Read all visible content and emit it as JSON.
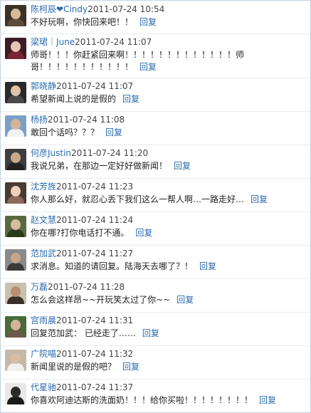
{
  "reply_label": "回复",
  "comments": [
    {
      "name": "陈柯辰",
      "heart": "❤",
      "name2": "Cindy",
      "time": "2011-07-24 10:54",
      "text": "不好玩啊，你快回来吧！！"
    },
    {
      "name": "梁珺",
      "sep": "｜",
      "name2": "June",
      "time": "2011-07-24 11:07",
      "text": "师哥！！！你赶紧回来啊！！！！！！！！！！！！！师哥！！！！！！！！！！！"
    },
    {
      "name": "郭晓静",
      "time": "2011-07-24 11:07",
      "text": "希望新闻上说的是假的"
    },
    {
      "name": "杨扬",
      "time": "2011-07-24 11:08",
      "text": "敢回个话吗？？？"
    },
    {
      "name": "何彦Justin",
      "time": "2011-07-24 11:20",
      "text": "我说兄弟，在那边一定好好做新闻！"
    },
    {
      "name": "沈芳旌",
      "time": "2011-07-24 11:23",
      "text": "你人那么好，就忍心丢下我们这么一帮人啊…一路走好…"
    },
    {
      "name": "赵文慧",
      "time": "2011-07-24 11:24",
      "text": "你在哪?打你电话打不通。"
    },
    {
      "name": "范加武",
      "time": "2011-07-24 11:27",
      "text": "求消息。知道的请回复。陆海天去哪了？！"
    },
    {
      "name": "万磊",
      "time": "2011-07-24 11:28",
      "text": "怎么会这样昂~~开玩笑太过了你~~"
    },
    {
      "name": "宫雨晨",
      "time": "2011-07-24 11:31",
      "text": "回复范加武： 已经走了……"
    },
    {
      "name": "广院喵",
      "time": "2011-07-24 11:32",
      "text": "新闻里说的是假的吧？"
    },
    {
      "name": "代星驰",
      "time": "2011-07-24 11:37",
      "text": "你喜欢阿迪达斯的洗面奶！！！给你买啦！！！！！！！！"
    }
  ],
  "avatar_colors": [
    [
      "#3a3226",
      "#d9b89a",
      "#5a4a3a"
    ],
    [
      "#3b1c24",
      "#e8c4b4",
      "#7a2434"
    ],
    [
      "#2a2a2a",
      "#e0c2a8",
      "#4a4a4a"
    ],
    [
      "#7aa0c8",
      "#d4b498",
      "#f2f2f2"
    ],
    [
      "#3e3e3e",
      "#caa88c",
      "#222222"
    ],
    [
      "#4a3a30",
      "#ecd0bc",
      "#8a6a58"
    ],
    [
      "#5a6a40",
      "#d8bca0",
      "#2a3a1a"
    ],
    [
      "#8a8a8a",
      "#c8a488",
      "#3a3a3a"
    ],
    [
      "#c8c0b0",
      "#b89070",
      "#3a3028"
    ],
    [
      "#4a6a3a",
      "#d4b49a",
      "#6a5a4a"
    ],
    [
      "#c4b8a8",
      "#d8bca4",
      "#f0f0f0"
    ],
    [
      "#e8e8e8",
      "#2a2a2a",
      "#1a1a1a"
    ]
  ]
}
